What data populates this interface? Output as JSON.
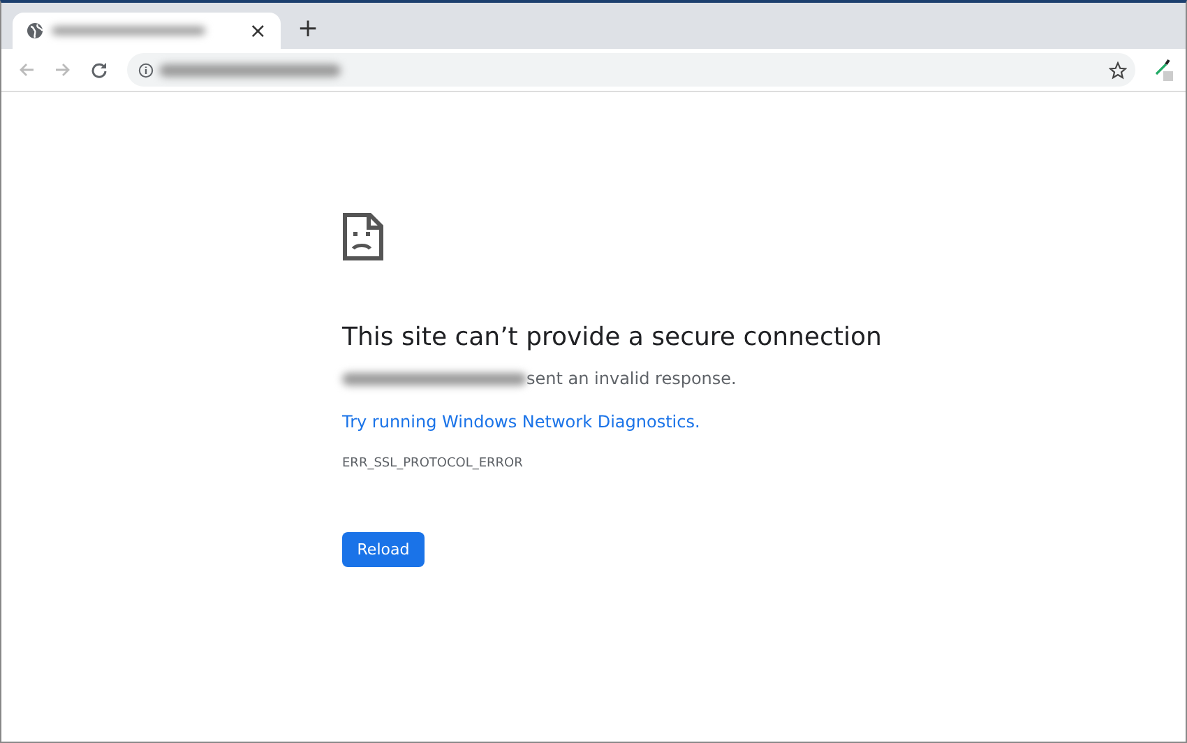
{
  "tabs": [
    {
      "selected": true,
      "close": "×"
    }
  ],
  "new_tab": "+",
  "error": {
    "title": "This site can’t provide a secure connection",
    "message": "sent an invalid response.",
    "link": "Try running Windows Network Diagnostics.",
    "code": "ERR_SSL_PROTOCOL_ERROR",
    "button": "Reload"
  }
}
